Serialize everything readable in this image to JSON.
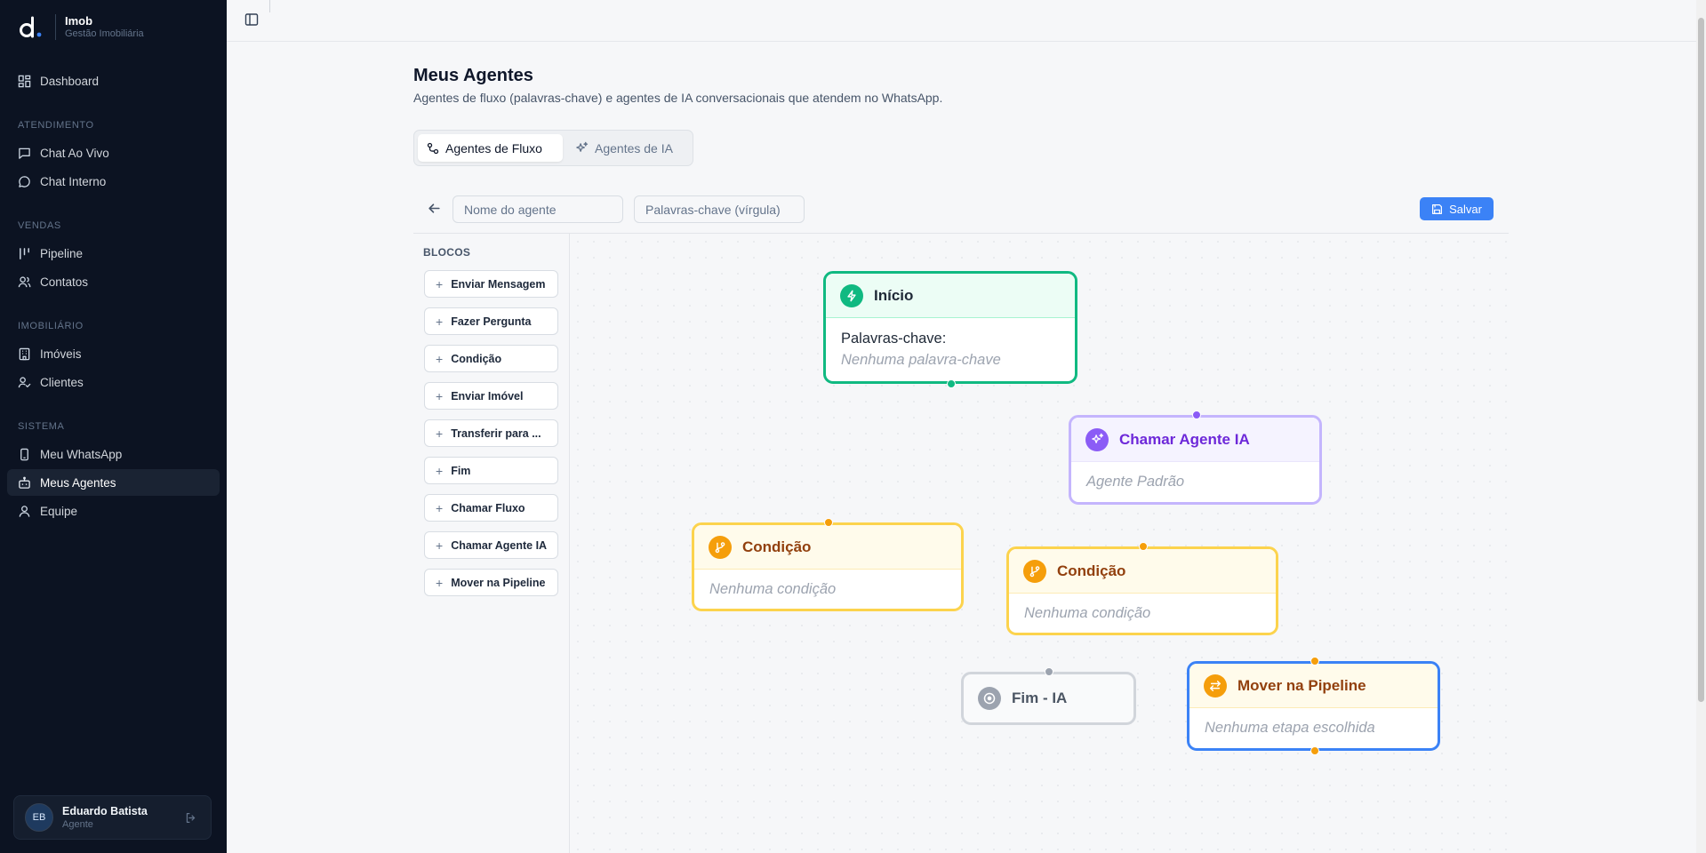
{
  "app": {
    "name": "Imob",
    "subtitle": "Gestão Imobiliária"
  },
  "nav": {
    "dashboard": "Dashboard",
    "section_atendimento": "ATENDIMENTO",
    "chat_ao_vivo": "Chat Ao Vivo",
    "chat_interno": "Chat Interno",
    "section_vendas": "VENDAS",
    "pipeline": "Pipeline",
    "contatos": "Contatos",
    "section_imobiliario": "IMOBILIÁRIO",
    "imoveis": "Imóveis",
    "clientes": "Clientes",
    "section_sistema": "SISTEMA",
    "meu_whatsapp": "Meu WhatsApp",
    "meus_agentes": "Meus Agentes",
    "equipe": "Equipe"
  },
  "user": {
    "initials": "EB",
    "name": "Eduardo Batista",
    "role": "Agente"
  },
  "page": {
    "title": "Meus Agentes",
    "description": "Agentes de fluxo (palavras-chave) e agentes de IA conversacionais que atendem no WhatsApp."
  },
  "tabs": {
    "flow": "Agentes de Fluxo",
    "ai": "Agentes de IA"
  },
  "editor": {
    "name_placeholder": "Nome do agente",
    "keywords_placeholder": "Palavras-chave (vírgula)",
    "save_label": "Salvar"
  },
  "blocks": {
    "title": "BLOCOS",
    "items": [
      "Enviar Mensagem",
      "Fazer Pergunta",
      "Condição",
      "Enviar Imóvel",
      "Transferir para ...",
      "Fim",
      "Chamar Fluxo",
      "Chamar Agente IA",
      "Mover na Pipeline"
    ]
  },
  "nodes": {
    "inicio": {
      "title": "Início",
      "label": "Palavras-chave:",
      "empty": "Nenhuma palavra-chave"
    },
    "chamar_ia": {
      "title": "Chamar Agente IA",
      "value": "Agente Padrão"
    },
    "condicao_1": {
      "title": "Condição",
      "empty": "Nenhuma condição"
    },
    "condicao_2": {
      "title": "Condição",
      "empty": "Nenhuma condição"
    },
    "fim": {
      "title": "Fim - IA"
    },
    "mover_pipeline": {
      "title": "Mover na Pipeline",
      "empty": "Nenhuma etapa escolhida"
    }
  },
  "colors": {
    "sidebar_bg": "#0c1322",
    "accent_blue": "#3b82f6",
    "start_green": "#10b981",
    "ai_purple": "#8b5cf6",
    "condition_amber": "#f59e0b",
    "end_gray": "#9ca3af"
  },
  "icons": [
    "d-logo",
    "layout-grid-icon",
    "message-square-icon",
    "message-circle-icon",
    "columns-icon",
    "users-icon",
    "building-icon",
    "user-check-icon",
    "smartphone-icon",
    "bot-icon",
    "user-icon",
    "logout-icon",
    "sidebar-toggle-icon",
    "workflow-icon",
    "sparkles-icon",
    "arrow-left-icon",
    "save-icon",
    "plus-icon",
    "zap-icon",
    "git-branch-icon",
    "stop-circle-icon",
    "arrow-left-right-icon"
  ]
}
